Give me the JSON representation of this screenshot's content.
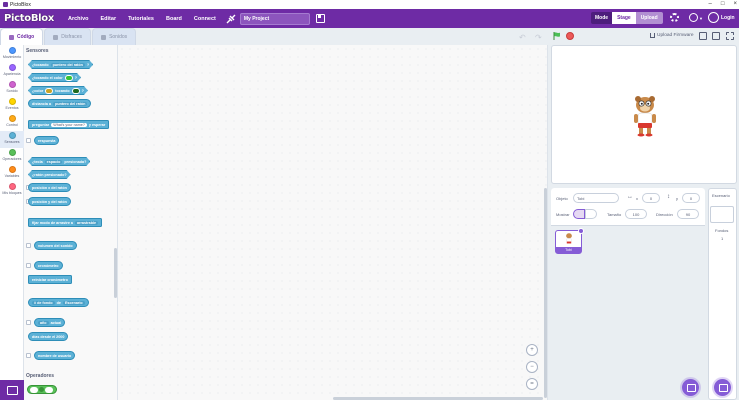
{
  "window": {
    "title": "PictoBlox"
  },
  "menubar": {
    "logo": "PictoBlox",
    "items": [
      "Archivo",
      "Editar",
      "Tutoriales",
      "Board",
      "Connect"
    ],
    "project_name": "My Project",
    "mode_label": "Mode",
    "mode_stage": "Stage",
    "mode_upload": "Upload",
    "login": "Login"
  },
  "tabs": {
    "code": "Código",
    "costumes": "Disfraces",
    "sounds": "Sonidos"
  },
  "categories": [
    {
      "label": "Movimiento",
      "color": "#4c97ff"
    },
    {
      "label": "Apariencia",
      "color": "#9966ff"
    },
    {
      "label": "Sonido",
      "color": "#cf63cf"
    },
    {
      "label": "Eventos",
      "color": "#ffd500"
    },
    {
      "label": "Control",
      "color": "#ffab19"
    },
    {
      "label": "Sensores",
      "color": "#5cb1d6"
    },
    {
      "label": "Operadores",
      "color": "#59c059"
    },
    {
      "label": "Variables",
      "color": "#ff8c1a"
    },
    {
      "label": "Mis bloques",
      "color": "#ff6680"
    }
  ],
  "palette": {
    "sensing_header": "Sensores",
    "operators_header": "Operadores",
    "blocks": {
      "touching": "¿tocando",
      "touching_menu": "puntero del ratón",
      "touching_q": "?",
      "touching_color": "¿tocando el color",
      "color_a": "¿color",
      "color_touching": "tocando",
      "distance": "distancia a",
      "distance_menu": "puntero del ratón",
      "ask": "preguntar",
      "ask_default": "What's your name?",
      "ask_wait": "y esperar",
      "answer": "respuesta",
      "key": "¿tecla",
      "key_menu": "espacio",
      "key_pressed": "presionada?",
      "mouse_down": "¿ratón presionado?",
      "mouse_x": "posición x del ratón",
      "mouse_y": "posición y del ratón",
      "drag_mode": "fijar modo de arrastre a",
      "drag_menu": "arrastrable",
      "loudness": "volumen del sonido",
      "timer": "cronómetro",
      "reset_timer": "reiniciar cronómetro",
      "backdrop_num": "# de fondo",
      "of": "de",
      "of_menu": "Escenario",
      "current": "actual",
      "year": "año",
      "days_since": "días desde el 2000",
      "username": "nombre de usuario"
    }
  },
  "stage_toolbar": {
    "upload_firmware": "Upload Firmware"
  },
  "sprite_info": {
    "sprite_label": "Objeto",
    "sprite_name": "Tobi",
    "x_label": "x",
    "x_value": "0",
    "y_label": "y",
    "y_value": "0",
    "show_label": "Mostrar",
    "size_label": "Tamaño",
    "size_value": "100",
    "direction_label": "Dirección",
    "direction_value": "90"
  },
  "sprites": [
    {
      "name": "Tobi"
    }
  ],
  "stage_panel": {
    "title": "Escenario",
    "backdrops_label": "Fondos",
    "backdrops_count": "1"
  }
}
